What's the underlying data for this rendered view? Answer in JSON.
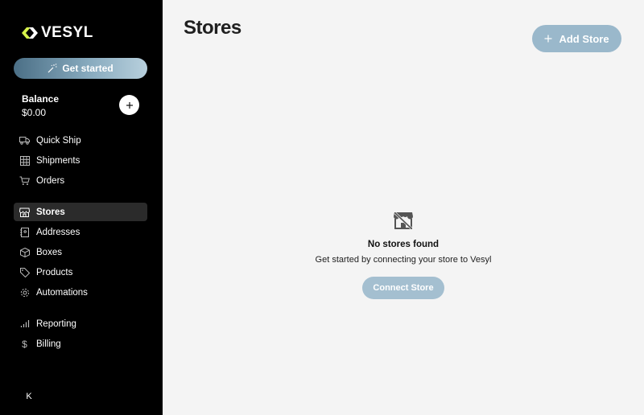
{
  "brand": {
    "name": "VESYL",
    "accent": "#d7f24b"
  },
  "sidebar": {
    "get_started_label": "Get started",
    "balance": {
      "label": "Balance",
      "value": "$0.00"
    },
    "collapse_glyph": "K",
    "nav_primary": [
      {
        "label": "Quick Ship",
        "icon": "truck-icon"
      },
      {
        "label": "Shipments",
        "icon": "grid-icon"
      },
      {
        "label": "Orders",
        "icon": "cart-icon"
      }
    ],
    "nav_secondary": [
      {
        "label": "Stores",
        "icon": "store-icon",
        "active": true
      },
      {
        "label": "Addresses",
        "icon": "address-book-icon"
      },
      {
        "label": "Boxes",
        "icon": "box-icon"
      },
      {
        "label": "Products",
        "icon": "tag-icon"
      },
      {
        "label": "Automations",
        "icon": "gear-icon"
      }
    ],
    "nav_tertiary": [
      {
        "label": "Reporting",
        "icon": "bar-chart-icon"
      },
      {
        "label": "Billing",
        "icon": "dollar-icon"
      }
    ]
  },
  "main": {
    "title": "Stores",
    "add_store_label": "Add Store",
    "empty_state": {
      "icon": "store-off-icon",
      "title": "No stores found",
      "subtitle": "Get started by connecting your store to Vesyl",
      "button_label": "Connect Store"
    }
  },
  "colors": {
    "sidebar_bg": "#000000",
    "main_bg": "#f4f4f4",
    "button_blue": "#9ab8cb",
    "active_nav_bg": "#2b2b2b"
  }
}
